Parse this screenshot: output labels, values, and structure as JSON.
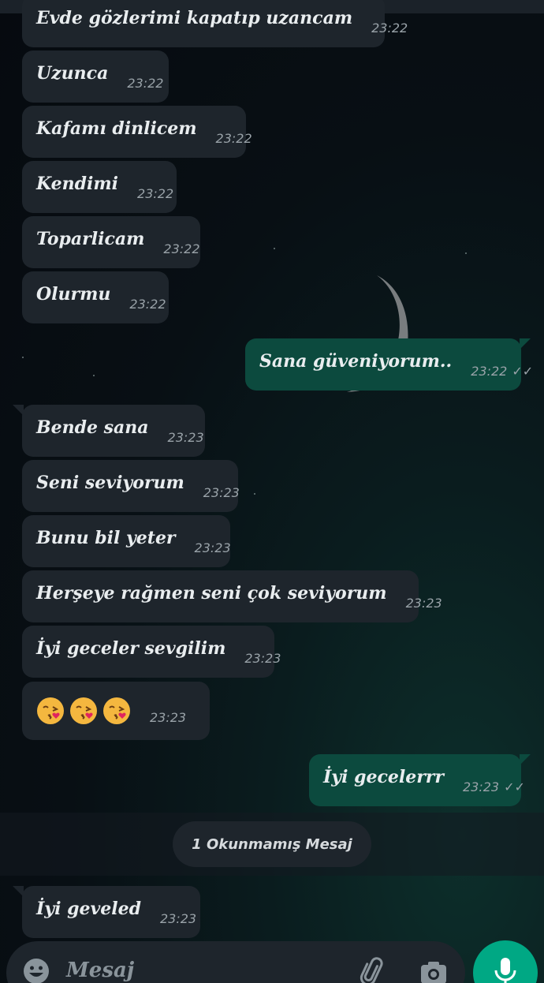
{
  "messages": [
    {
      "text": "Evde gözlerimi kapatıp uzancam",
      "time": "23:22",
      "dir": "in"
    },
    {
      "text": "Uzunca",
      "time": "23:22",
      "dir": "in"
    },
    {
      "text": "Kafamı dinlicem",
      "time": "23:22",
      "dir": "in"
    },
    {
      "text": "Kendimi",
      "time": "23:22",
      "dir": "in"
    },
    {
      "text": "Toparlicam",
      "time": "23:22",
      "dir": "in"
    },
    {
      "text": "Olurmu",
      "time": "23:22",
      "dir": "in"
    },
    {
      "text": "Sana güveniyorum..",
      "time": "23:22",
      "dir": "out",
      "status": "read"
    },
    {
      "text": "Bende sana",
      "time": "23:23",
      "dir": "in"
    },
    {
      "text": "Seni seviyorum",
      "time": "23:23",
      "dir": "in"
    },
    {
      "text": "Bunu bil yeter",
      "time": "23:23",
      "dir": "in"
    },
    {
      "text": "Herşeye rağmen seni çok seviyorum",
      "time": "23:23",
      "dir": "in"
    },
    {
      "text": "İyi geceler sevgilim",
      "time": "23:23",
      "dir": "in"
    },
    {
      "emoji": [
        "kissing-face-with-heart",
        "kissing-face-with-heart",
        "kissing-face-with-heart"
      ],
      "time": "23:23",
      "dir": "in"
    },
    {
      "text": "İyi gecelerrr",
      "time": "23:23",
      "dir": "out",
      "status": "read"
    },
    {
      "text": "İyi geveled",
      "time": "23:23",
      "dir": "in"
    }
  ],
  "unread_divider": "1 Okunmamış Mesaj",
  "composer": {
    "placeholder": "Mesaj",
    "icons": [
      "emoji-icon",
      "attach-icon",
      "camera-icon"
    ]
  },
  "mic_button": "microphone-icon",
  "colors": {
    "incoming_bubble": "#1e252c",
    "outgoing_bubble": "#0c4a3e",
    "accent": "#00a884",
    "read_ticks": "#9aa3a9"
  }
}
